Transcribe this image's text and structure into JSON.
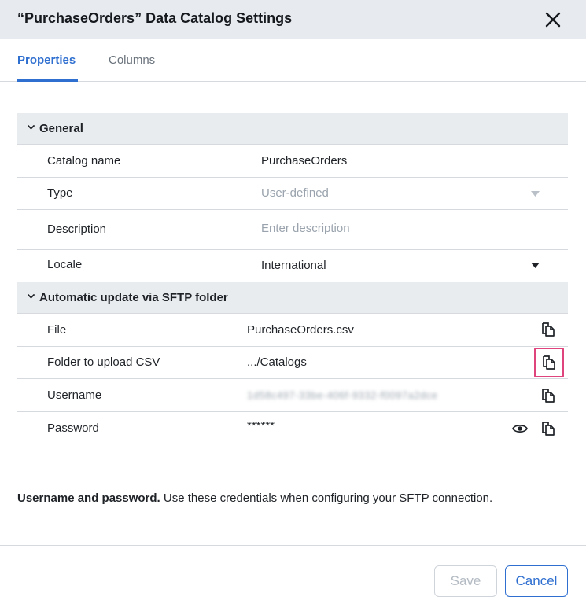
{
  "dialog": {
    "title": "“PurchaseOrders” Data Catalog Settings"
  },
  "tabs": [
    {
      "label": "Properties",
      "active": true
    },
    {
      "label": "Columns",
      "active": false
    }
  ],
  "general": {
    "header": "General",
    "catalog_name_label": "Catalog name",
    "catalog_name_value": "PurchaseOrders",
    "type_label": "Type",
    "type_value": "User-defined",
    "description_label": "Description",
    "description_placeholder": "Enter description",
    "locale_label": "Locale",
    "locale_value": "International"
  },
  "sftp": {
    "header": "Automatic update via SFTP folder",
    "file_label": "File",
    "file_value": "PurchaseOrders.csv",
    "folder_label": "Folder to upload CSV",
    "folder_value": ".../Catalogs",
    "username_label": "Username",
    "username_value": "1d58c497-33be-406f-9332-f0097a2dce",
    "password_label": "Password",
    "password_value": "******"
  },
  "note": {
    "bold": "Username and password.",
    "text": " Use these credentials when configuring your SFTP connection."
  },
  "buttons": {
    "save": "Save",
    "cancel": "Cancel"
  },
  "colors": {
    "accent": "#2f6fd0",
    "highlight": "#e0447c",
    "header_bg": "#e7eaee"
  },
  "icons": {
    "close": "close-icon",
    "chevron": "chevron-down-icon",
    "copy": "copy-icon",
    "eye": "eye-icon",
    "caret": "caret-down-icon"
  }
}
